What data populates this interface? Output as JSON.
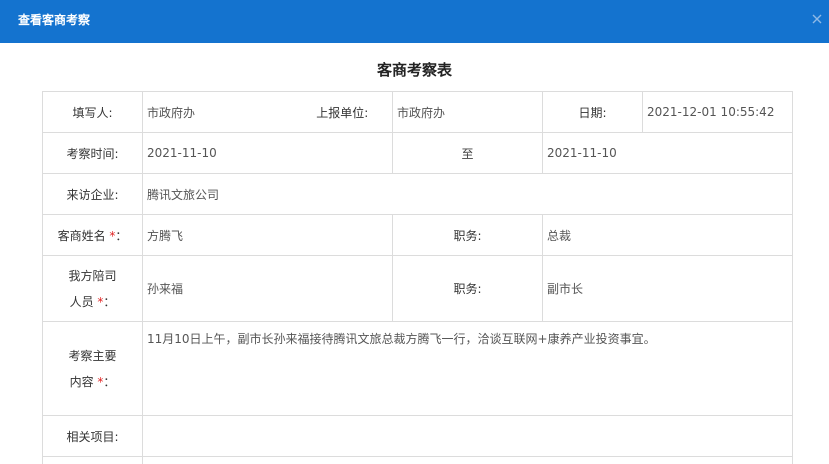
{
  "window": {
    "title": "查看客商考察",
    "close_icon": "close-icon"
  },
  "form": {
    "heading": "客商考察表",
    "rows": {
      "filler_label": "填写人:",
      "filler_value": "市政府办",
      "unit_label": "上报单位:",
      "unit_value": "市政府办",
      "date_label": "日期:",
      "date_value": "2021-12-01 10:55:42",
      "inspect_time_label": "考察时间:",
      "inspect_start": "2021-11-10",
      "to_label": "至",
      "inspect_end": "2021-11-10",
      "company_label": "来访企业:",
      "company_value": "腾讯文旅公司",
      "guest_name_label": "客商姓名",
      "guest_name_value": "方腾飞",
      "guest_title_label": "职务:",
      "guest_title_value": "总裁",
      "host_label_line1": "我方陪司",
      "host_label_line2": "人员",
      "host_value": "孙来福",
      "host_title_label": "职务:",
      "host_title_value": "副市长",
      "content_label_line1": "考察主要",
      "content_label_line2": "内容",
      "content_value": "11月10日上午，副市长孙来福接待腾讯文旅总裁方腾飞一行，洽谈互联网+康养产业投资事宜。",
      "project_label": "相关项目:",
      "project_value": ""
    },
    "required_mark": "*",
    "colon": "："
  },
  "colors": {
    "titlebar": "#1473cf",
    "required": "#e02222",
    "border": "#dcdcdc"
  }
}
